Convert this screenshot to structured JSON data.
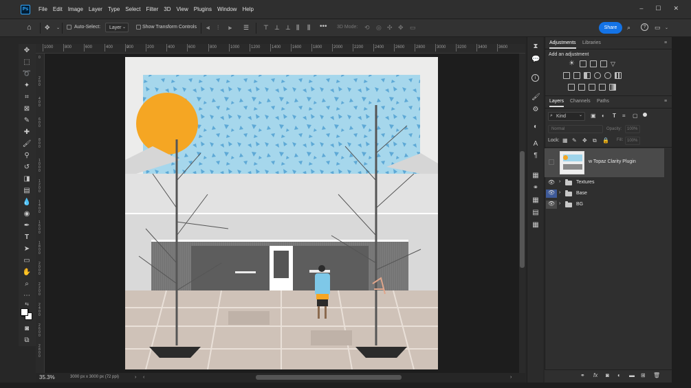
{
  "app": {
    "logo_text": "Ps",
    "accent": "#1473e6"
  },
  "menu": [
    "File",
    "Edit",
    "Image",
    "Layer",
    "Type",
    "Select",
    "Filter",
    "3D",
    "View",
    "Plugins",
    "Window",
    "Help"
  ],
  "window_controls": [
    "–",
    "☐",
    "✕"
  ],
  "options": {
    "auto_select_label": "Auto-Select:",
    "auto_select_value": "Layer",
    "show_transform_label": "Show Transform Controls",
    "three_d_mode_label": "3D Mode:",
    "share_label": "Share"
  },
  "rulers": {
    "top": [
      "1000",
      "800",
      "600",
      "400",
      "200",
      "0",
      "200",
      "400",
      "600",
      "800",
      "1000",
      "1200",
      "1400",
      "1600",
      "1800",
      "2000",
      "2200",
      "2400",
      "2600",
      "2800",
      "3000",
      "3200",
      "3400",
      "3600"
    ],
    "left": [
      "0",
      "2\n0\n0",
      "4\n0\n0",
      "6\n0\n0",
      "8\n0\n0",
      "1\n0\n0\n0",
      "1\n2\n0\n0",
      "1\n4\n0\n0",
      "1\n6\n0\n0",
      "1\n8\n0\n0",
      "2\n0\n0\n0",
      "2\n2\n0\n0",
      "2\n4\n0\n0",
      "2\n6\n0\n0",
      "2\n8\n0\n0"
    ]
  },
  "status": {
    "zoom": "35.3%",
    "doc_info": "3000 px x 3000 px (72 ppi)"
  },
  "panels": {
    "adjustments": {
      "tab_active": "Adjustments",
      "tab_other": "Libraries",
      "add_label": "Add an adjustment"
    },
    "layers": {
      "tabs": [
        "Layers",
        "Channels",
        "Paths"
      ],
      "kind_label": "Kind",
      "blend_mode": "Normal",
      "opacity_label": "Opacity:",
      "opacity_value": "100%",
      "lock_label": "Lock:",
      "fill_label": "Fill:",
      "fill_value": "100%",
      "items": [
        {
          "name": "w Topaz Clarity Plugin",
          "type": "smart",
          "visible": false,
          "selected": true
        },
        {
          "name": "Textures",
          "type": "group",
          "visible": true
        },
        {
          "name": "Base",
          "type": "group",
          "visible": true
        },
        {
          "name": "BG",
          "type": "group",
          "visible": true
        }
      ],
      "footer_icons": [
        "link-icon",
        "fx-icon",
        "mask-icon",
        "adjustment-icon",
        "folder-icon",
        "new-layer-icon",
        "trash-icon"
      ]
    }
  },
  "colors": {
    "sky": "#9fd4ea",
    "sun": "#f5a623",
    "canvas_bg": "#ececeb",
    "building": "#5f5f5f"
  }
}
